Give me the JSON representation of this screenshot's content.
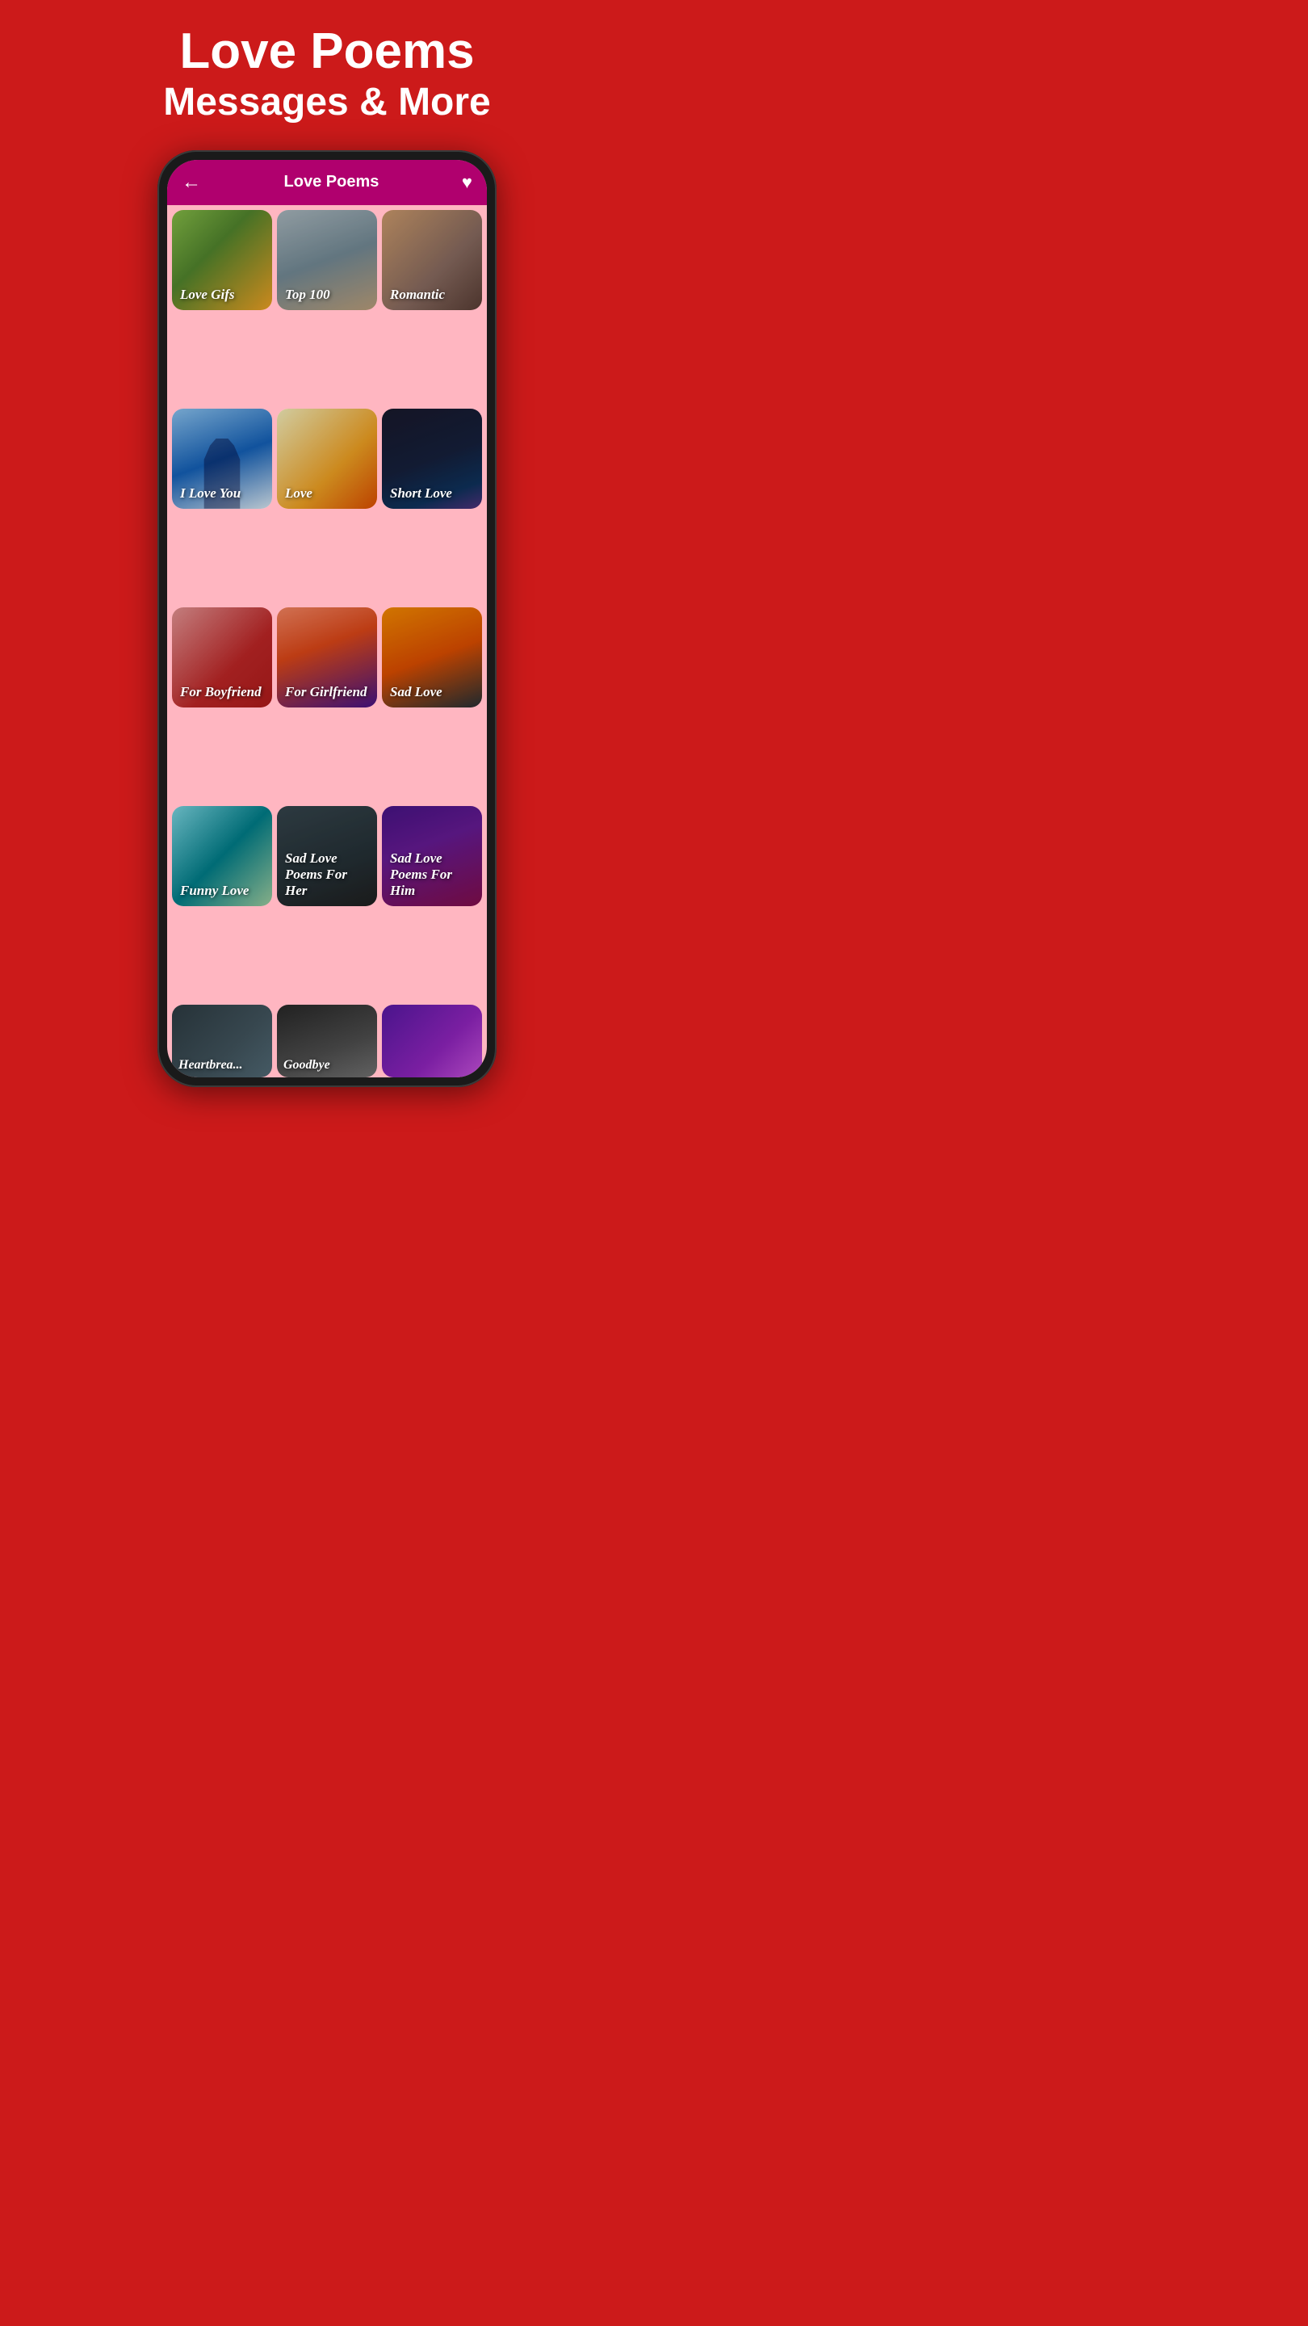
{
  "page": {
    "background_color": "#cc1a1a",
    "header": {
      "title": "Love Poems",
      "subtitle": "Messages & More"
    },
    "appbar": {
      "back_label": "←",
      "title": "Love Poems",
      "heart_icon": "♥"
    },
    "grid_items": [
      {
        "id": "love-gifs",
        "label": "Love Gifs",
        "card_class": "card-love-gifs"
      },
      {
        "id": "top100",
        "label": "Top 100",
        "card_class": "card-top100"
      },
      {
        "id": "romantic",
        "label": "Romantic",
        "card_class": "card-romantic"
      },
      {
        "id": "i-love-you",
        "label": "I Love You",
        "card_class": "card-iloveyou"
      },
      {
        "id": "love",
        "label": "Love",
        "card_class": "card-love"
      },
      {
        "id": "short-love",
        "label": "Short Love",
        "card_class": "card-shortlove"
      },
      {
        "id": "for-boyfriend",
        "label": "For Boyfriend",
        "card_class": "card-forboyfriend"
      },
      {
        "id": "for-girlfriend",
        "label": "For Girlfriend",
        "card_class": "card-forgirlfriend"
      },
      {
        "id": "sad-love",
        "label": "Sad Love",
        "card_class": "card-sadlove"
      },
      {
        "id": "funny-love",
        "label": "Funny Love",
        "card_class": "card-funnylove"
      },
      {
        "id": "sad-love-her",
        "label": "Sad Love Poems For Her",
        "card_class": "card-sadloveher"
      },
      {
        "id": "sad-love-him",
        "label": "Sad Love Poems For Him",
        "card_class": "card-sadlovehim"
      }
    ],
    "partial_items": [
      {
        "id": "heartbreak",
        "label": "Heartbrea...",
        "card_class": "card-heartbreak"
      },
      {
        "id": "goodbye",
        "label": "Goodbye",
        "card_class": "card-goodbye"
      },
      {
        "id": "extra",
        "label": "",
        "card_class": "card-extra"
      }
    ]
  }
}
